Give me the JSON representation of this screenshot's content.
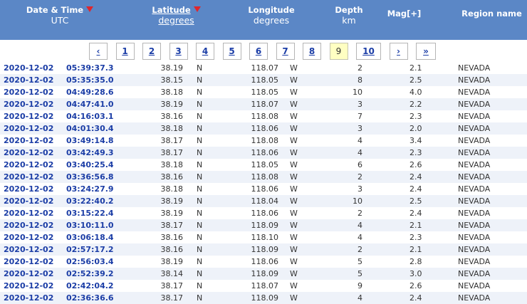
{
  "theme": {
    "header_bg": "#5b87c6",
    "link": "#1b3da6",
    "sort_icon": "#e0262c",
    "current_page_bg": "#ffffc2",
    "row_alt_bg": "#eef2f9"
  },
  "header": {
    "datetime": {
      "label": "Date & Time",
      "sub": "UTC",
      "icon": "sort-desc-icon"
    },
    "latitude": {
      "label": "Latitude",
      "sub": "degrees",
      "icon": "sort-desc-icon"
    },
    "longitude": {
      "label": "Longitude",
      "sub": "degrees"
    },
    "depth": {
      "label": "Depth",
      "sub": "km"
    },
    "magnitude": {
      "label": "Mag[+]"
    },
    "region": {
      "label": "Region name"
    }
  },
  "pagination": {
    "prev_label": "‹",
    "pages": [
      {
        "label": "1"
      },
      {
        "label": "2"
      },
      {
        "label": "3"
      },
      {
        "label": "4"
      },
      {
        "label": "5"
      },
      {
        "label": "6"
      },
      {
        "label": "7"
      },
      {
        "label": "8"
      },
      {
        "label": "9",
        "current": true
      },
      {
        "label": "10"
      }
    ],
    "next_label": "›",
    "last_label": "»"
  },
  "rows": [
    {
      "date": "2020-12-02",
      "time": "05:39:37.3",
      "lat": "38.19",
      "lat_dir": "N",
      "lon": "118.07",
      "lon_dir": "W",
      "depth": "2",
      "mag": "2.1",
      "region": "NEVADA"
    },
    {
      "date": "2020-12-02",
      "time": "05:35:35.0",
      "lat": "38.15",
      "lat_dir": "N",
      "lon": "118.05",
      "lon_dir": "W",
      "depth": "8",
      "mag": "2.5",
      "region": "NEVADA"
    },
    {
      "date": "2020-12-02",
      "time": "04:49:28.6",
      "lat": "38.18",
      "lat_dir": "N",
      "lon": "118.05",
      "lon_dir": "W",
      "depth": "10",
      "mag": "4.0",
      "region": "NEVADA"
    },
    {
      "date": "2020-12-02",
      "time": "04:47:41.0",
      "lat": "38.19",
      "lat_dir": "N",
      "lon": "118.07",
      "lon_dir": "W",
      "depth": "3",
      "mag": "2.2",
      "region": "NEVADA"
    },
    {
      "date": "2020-12-02",
      "time": "04:16:03.1",
      "lat": "38.16",
      "lat_dir": "N",
      "lon": "118.08",
      "lon_dir": "W",
      "depth": "7",
      "mag": "2.3",
      "region": "NEVADA"
    },
    {
      "date": "2020-12-02",
      "time": "04:01:30.4",
      "lat": "38.18",
      "lat_dir": "N",
      "lon": "118.06",
      "lon_dir": "W",
      "depth": "3",
      "mag": "2.0",
      "region": "NEVADA"
    },
    {
      "date": "2020-12-02",
      "time": "03:49:14.8",
      "lat": "38.17",
      "lat_dir": "N",
      "lon": "118.08",
      "lon_dir": "W",
      "depth": "4",
      "mag": "3.4",
      "region": "NEVADA"
    },
    {
      "date": "2020-12-02",
      "time": "03:42:49.3",
      "lat": "38.17",
      "lat_dir": "N",
      "lon": "118.06",
      "lon_dir": "W",
      "depth": "4",
      "mag": "2.3",
      "region": "NEVADA"
    },
    {
      "date": "2020-12-02",
      "time": "03:40:25.4",
      "lat": "38.18",
      "lat_dir": "N",
      "lon": "118.05",
      "lon_dir": "W",
      "depth": "6",
      "mag": "2.6",
      "region": "NEVADA"
    },
    {
      "date": "2020-12-02",
      "time": "03:36:56.8",
      "lat": "38.16",
      "lat_dir": "N",
      "lon": "118.08",
      "lon_dir": "W",
      "depth": "2",
      "mag": "2.4",
      "region": "NEVADA"
    },
    {
      "date": "2020-12-02",
      "time": "03:24:27.9",
      "lat": "38.18",
      "lat_dir": "N",
      "lon": "118.06",
      "lon_dir": "W",
      "depth": "3",
      "mag": "2.4",
      "region": "NEVADA"
    },
    {
      "date": "2020-12-02",
      "time": "03:22:40.2",
      "lat": "38.19",
      "lat_dir": "N",
      "lon": "118.04",
      "lon_dir": "W",
      "depth": "10",
      "mag": "2.5",
      "region": "NEVADA"
    },
    {
      "date": "2020-12-02",
      "time": "03:15:22.4",
      "lat": "38.19",
      "lat_dir": "N",
      "lon": "118.06",
      "lon_dir": "W",
      "depth": "2",
      "mag": "2.4",
      "region": "NEVADA"
    },
    {
      "date": "2020-12-02",
      "time": "03:10:11.0",
      "lat": "38.17",
      "lat_dir": "N",
      "lon": "118.09",
      "lon_dir": "W",
      "depth": "4",
      "mag": "2.1",
      "region": "NEVADA"
    },
    {
      "date": "2020-12-02",
      "time": "03:06:18.4",
      "lat": "38.16",
      "lat_dir": "N",
      "lon": "118.10",
      "lon_dir": "W",
      "depth": "4",
      "mag": "2.3",
      "region": "NEVADA"
    },
    {
      "date": "2020-12-02",
      "time": "02:57:17.2",
      "lat": "38.16",
      "lat_dir": "N",
      "lon": "118.09",
      "lon_dir": "W",
      "depth": "2",
      "mag": "2.1",
      "region": "NEVADA"
    },
    {
      "date": "2020-12-02",
      "time": "02:56:03.4",
      "lat": "38.19",
      "lat_dir": "N",
      "lon": "118.06",
      "lon_dir": "W",
      "depth": "5",
      "mag": "2.8",
      "region": "NEVADA"
    },
    {
      "date": "2020-12-02",
      "time": "02:52:39.2",
      "lat": "38.14",
      "lat_dir": "N",
      "lon": "118.09",
      "lon_dir": "W",
      "depth": "5",
      "mag": "3.0",
      "region": "NEVADA"
    },
    {
      "date": "2020-12-02",
      "time": "02:42:04.2",
      "lat": "38.17",
      "lat_dir": "N",
      "lon": "118.07",
      "lon_dir": "W",
      "depth": "9",
      "mag": "2.6",
      "region": "NEVADA"
    },
    {
      "date": "2020-12-02",
      "time": "02:36:36.6",
      "lat": "38.17",
      "lat_dir": "N",
      "lon": "118.09",
      "lon_dir": "W",
      "depth": "4",
      "mag": "2.4",
      "region": "NEVADA"
    }
  ]
}
